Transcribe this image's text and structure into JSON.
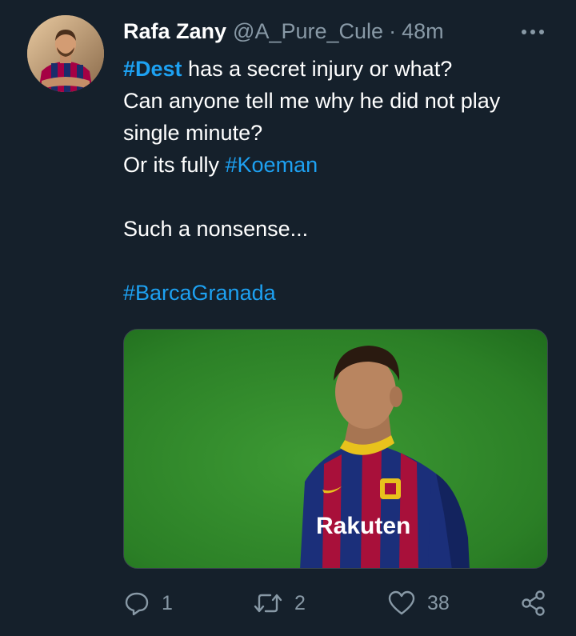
{
  "author": {
    "name": "Rafa Zany",
    "handle": "@A_Pure_Cule",
    "separator": "·",
    "time": "48m"
  },
  "tweet": {
    "lines": [
      {
        "hashtag": "#Dest",
        "rest": " has a secret injury or what?"
      },
      {
        "text": "Can anyone tell me why he did not play"
      },
      {
        "text": "single minute?"
      },
      {
        "prefix": "Or its fully ",
        "hashtag": "#Koeman"
      },
      {
        "text": "Such a nonsense..."
      },
      {
        "hashtag": "#BarcaGranada"
      }
    ]
  },
  "media": {
    "jersey_sponsor": "Rakuten"
  },
  "actions": {
    "reply_count": "1",
    "retweet_count": "2",
    "like_count": "38"
  },
  "icons": {
    "more": "more-horizontal-icon",
    "reply": "reply-icon",
    "retweet": "retweet-icon",
    "like": "heart-icon",
    "share": "share-icon"
  },
  "colors": {
    "background": "#15202b",
    "secondary_text": "#8899a6",
    "hashtag": "#1da1f2",
    "border": "#38444d"
  }
}
